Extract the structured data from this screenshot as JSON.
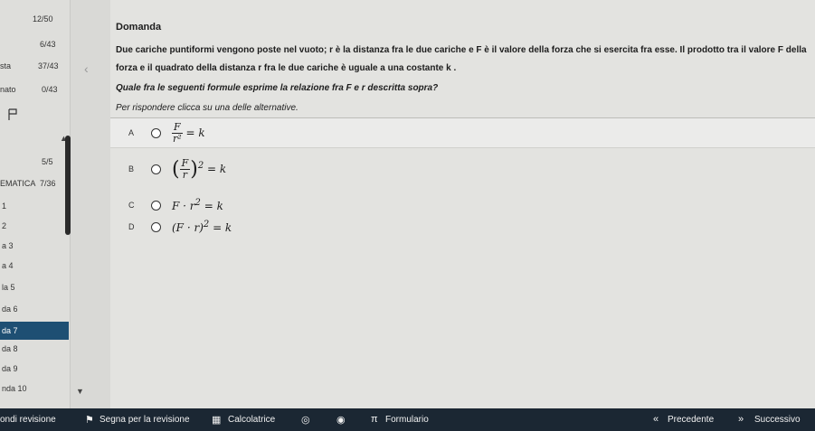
{
  "sidebar": {
    "stats": [
      "12/50",
      "6/43",
      "37/43",
      "0/43"
    ],
    "stat_labels": [
      "",
      "",
      "sta",
      "nato"
    ],
    "section_count": "5/5",
    "section_name": "EMATICA",
    "section_progress": "7/36",
    "items": [
      {
        "label": "1"
      },
      {
        "label": "2"
      },
      {
        "label": "a 3"
      },
      {
        "label": "a 4"
      },
      {
        "label": "la 5"
      },
      {
        "label": "da 6"
      },
      {
        "label": "da 7",
        "active": true
      },
      {
        "label": "da 8"
      },
      {
        "label": "da 9"
      },
      {
        "label": "nda 10"
      }
    ]
  },
  "question": {
    "title": "Domanda",
    "text": "Due cariche puntiformi vengono poste nel vuoto; r è la distanza fra le due cariche e F è il valore della forza che si esercita fra esse. Il prodotto tra il valore F della forza e il quadrato della distanza r fra le due cariche è uguale a una costante k .",
    "ask": "Quale fra le seguenti formule esprime la relazione fra F e r descritta sopra?",
    "instruction": "Per rispondere clicca su una delle alternative.",
    "choices": [
      {
        "letter": "A",
        "formula_desc": "F / r^2 = k"
      },
      {
        "letter": "B",
        "formula_desc": "(F / r)^2 = k"
      },
      {
        "letter": "C",
        "formula_desc": "F · r^2 = k"
      },
      {
        "letter": "D",
        "formula_desc": "(F · r)^2 = k"
      }
    ]
  },
  "bottombar": {
    "left_label": "ondi revisione",
    "review_label": "Segna per la revisione",
    "calc_label": "Calcolatrice",
    "formulary_label": "Formulario",
    "prev_label": "Precedente",
    "next_label": "Successivo"
  },
  "colors": {
    "active_item": "#1e4f73",
    "bottombar": "#1b2733"
  }
}
